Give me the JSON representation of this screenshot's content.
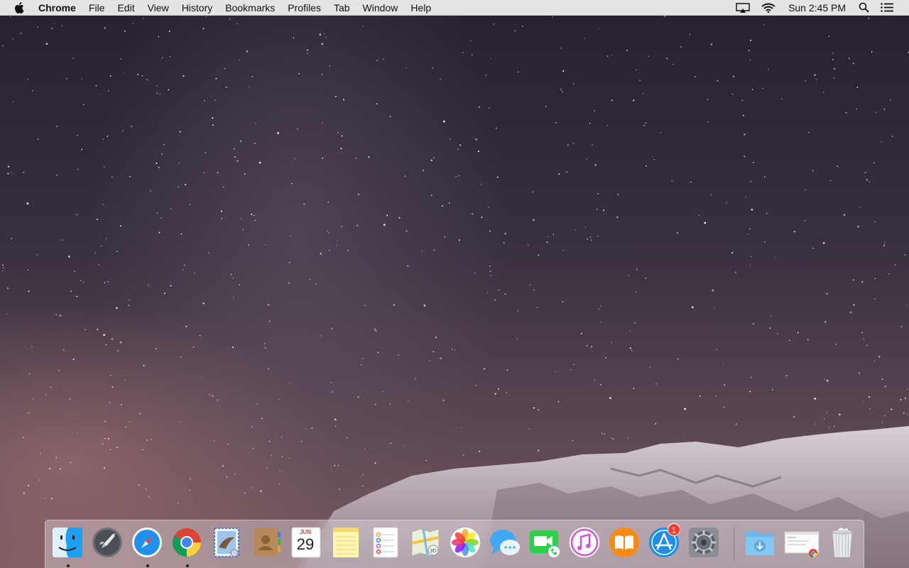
{
  "menubar": {
    "app_name": "Chrome",
    "menus": [
      "File",
      "Edit",
      "View",
      "History",
      "Bookmarks",
      "Profiles",
      "Tab",
      "Window",
      "Help"
    ],
    "clock": "Sun 2:45 PM",
    "status_icons": [
      "airplay-icon",
      "wifi-icon",
      "spotlight-search-icon",
      "notification-center-icon"
    ]
  },
  "dock": {
    "apps": [
      {
        "name": "Finder",
        "icon": "finder-icon",
        "running": true
      },
      {
        "name": "Launchpad",
        "icon": "launchpad-icon",
        "running": false
      },
      {
        "name": "Safari",
        "icon": "safari-icon",
        "running": true
      },
      {
        "name": "Google Chrome",
        "icon": "chrome-icon",
        "running": true
      },
      {
        "name": "Mail",
        "icon": "mail-icon",
        "running": false
      },
      {
        "name": "Contacts",
        "icon": "contacts-icon",
        "running": false
      },
      {
        "name": "Calendar",
        "icon": "calendar-icon",
        "running": false,
        "month": "JUN",
        "day": "29"
      },
      {
        "name": "Notes",
        "icon": "notes-icon",
        "running": false
      },
      {
        "name": "Reminders",
        "icon": "reminders-icon",
        "running": false
      },
      {
        "name": "Maps",
        "icon": "maps-icon",
        "running": false
      },
      {
        "name": "Photos",
        "icon": "photos-icon",
        "running": false
      },
      {
        "name": "Messages",
        "icon": "messages-icon",
        "running": false
      },
      {
        "name": "FaceTime",
        "icon": "facetime-icon",
        "running": false
      },
      {
        "name": "iTunes",
        "icon": "itunes-icon",
        "running": false
      },
      {
        "name": "iBooks",
        "icon": "ibooks-icon",
        "running": false
      },
      {
        "name": "App Store",
        "icon": "app-store-icon",
        "running": false,
        "badge": "1"
      },
      {
        "name": "System Preferences",
        "icon": "system-preferences-icon",
        "running": false
      }
    ],
    "stacks": [
      {
        "name": "Downloads",
        "icon": "downloads-folder-icon"
      },
      {
        "name": "Screenshot",
        "icon": "screenshot-thumbnail-icon"
      },
      {
        "name": "Trash",
        "icon": "trash-icon"
      }
    ]
  },
  "colors": {
    "menubar_bg": "#ececec",
    "badge": "#ff3b30",
    "dock_bg": "#e6dce1"
  }
}
